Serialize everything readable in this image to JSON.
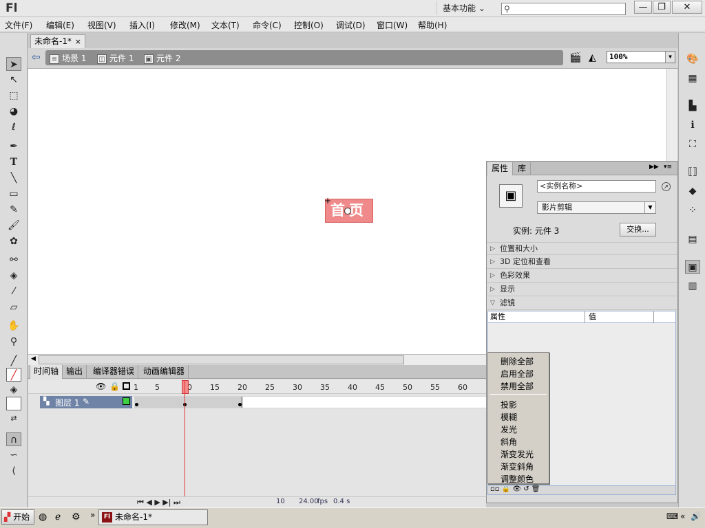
{
  "app": {
    "logo": "Fl",
    "workspace": "基本功能 ⌄",
    "min": "—",
    "restore": "❐",
    "close": "✕"
  },
  "menu": [
    "文件(F)",
    "编辑(E)",
    "视图(V)",
    "插入(I)",
    "修改(M)",
    "文本(T)",
    "命令(C)",
    "控制(O)",
    "调试(D)",
    "窗口(W)",
    "帮助(H)"
  ],
  "document": {
    "tab_title": "未命名-1*",
    "tab_close": "×"
  },
  "breadcrumb": {
    "back": "⇦",
    "scene": "场景 1",
    "symbol1": "元件 1",
    "symbol2": "元件 2"
  },
  "zoom": "100%",
  "stage": {
    "symbol_text": "首页",
    "symbol_color": "#f08a8a"
  },
  "timeline": {
    "tabs": [
      "时间轴",
      "输出",
      "编译器错误",
      "动画编辑器"
    ],
    "layer_name": "图层 1",
    "ruler": [
      "1",
      "5",
      "10",
      "15",
      "20",
      "25",
      "30",
      "35",
      "40",
      "45",
      "50",
      "55",
      "60"
    ],
    "current_frame": "10",
    "fps": "24.00",
    "fps_unit": "fps",
    "time": "0.4 s"
  },
  "properties": {
    "tabs": [
      "属性",
      "库"
    ],
    "instance_placeholder": "<实例名称>",
    "symbol_type": "影片剪辑",
    "instance_of": "实例: 元件 3",
    "swap_button": "交换...",
    "sections": [
      "位置和大小",
      "3D 定位和查看",
      "色彩效果",
      "显示",
      "滤镜"
    ],
    "filter_header": {
      "col1": "属性",
      "col2": "值"
    }
  },
  "context_menu": {
    "group1": [
      "删除全部",
      "启用全部",
      "禁用全部"
    ],
    "group2": [
      "投影",
      "模糊",
      "发光",
      "斜角",
      "渐变发光",
      "渐变斜角",
      "调整颜色"
    ]
  },
  "taskbar": {
    "start": "开始",
    "window": "未命名-1*",
    "fl_icon": "Fl",
    "more": "»"
  }
}
